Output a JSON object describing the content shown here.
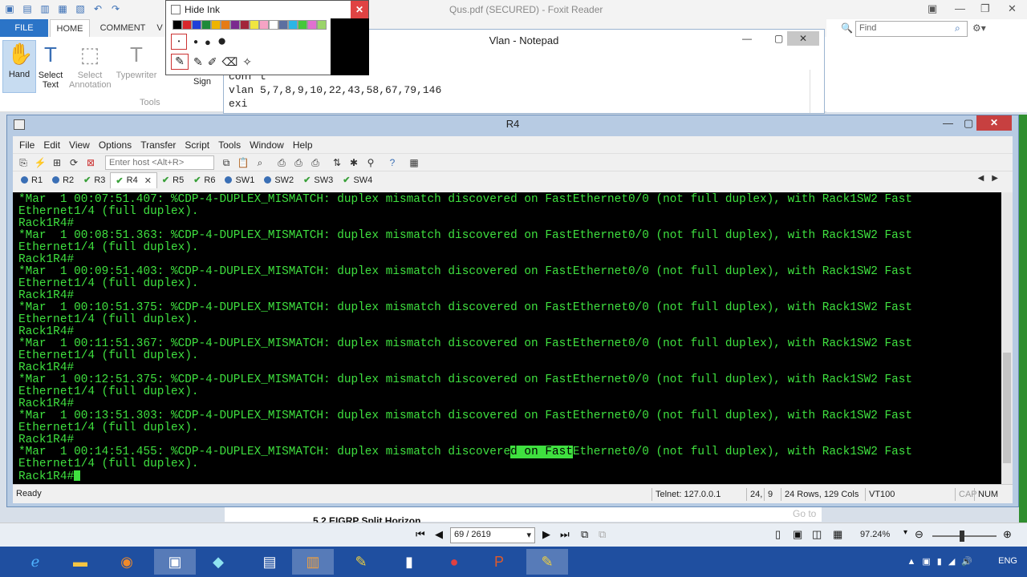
{
  "foxit": {
    "window_title": "Qus.pdf (SECURED) - Foxit Reader",
    "tabs": [
      "FILE",
      "HOME",
      "COMMENT",
      "V"
    ],
    "active_tab": "HOME",
    "ribbon": {
      "hand": "Hand",
      "select_text": "Select Text",
      "select_annotation": "Select Annotation",
      "typewriter": "Typewriter",
      "sign": "Sign",
      "tools_group": "Tools"
    },
    "find_placeholder": "Find",
    "page_heading_peek": "5.2    EIGRP Split Horizon",
    "goto_peek": "Go to",
    "page_selector": "69 / 2619",
    "zoom_level": "97.24%"
  },
  "ink_palette": {
    "hide_ink_label": "Hide Ink",
    "colors": [
      "#000000",
      "#d9262b",
      "#1f3fd9",
      "#1e8a3a",
      "#f0b400",
      "#e67b16",
      "#7b2a8f",
      "#a2253a",
      "#f0e640",
      "#f6a3c4",
      "#ffffff",
      "#5c6fa0",
      "#2bb5e6",
      "#46c83a",
      "#e070d0",
      "#9bd46a"
    ]
  },
  "notepad": {
    "title": "Vlan - Notepad",
    "lines": [
      "conf t",
      "vlan 5,7,8,9,10,22,43,58,67,79,146",
      "exi"
    ]
  },
  "securecrt": {
    "window_title": "R4",
    "menu": [
      "File",
      "Edit",
      "View",
      "Options",
      "Transfer",
      "Script",
      "Tools",
      "Window",
      "Help"
    ],
    "host_placeholder": "Enter host <Alt+R>",
    "sessions": [
      {
        "label": "R1",
        "state": "dot"
      },
      {
        "label": "R2",
        "state": "dot"
      },
      {
        "label": "R3",
        "state": "check"
      },
      {
        "label": "R4",
        "state": "check",
        "active": true
      },
      {
        "label": "R5",
        "state": "check"
      },
      {
        "label": "R6",
        "state": "check"
      },
      {
        "label": "SW1",
        "state": "dot"
      },
      {
        "label": "SW2",
        "state": "dot"
      },
      {
        "label": "SW3",
        "state": "check"
      },
      {
        "label": "SW4",
        "state": "check"
      }
    ],
    "terminal": {
      "log_entries": [
        {
          "msg": "*Mar  1 00:07:51.407: %CDP-4-DUPLEX_MISMATCH: duplex mismatch discovered on FastEthernet0/0 (not full duplex), with Rack1SW2 Fast",
          "cont": "Ethernet1/4 (full duplex)."
        },
        {
          "msg": "*Mar  1 00:08:51.363: %CDP-4-DUPLEX_MISMATCH: duplex mismatch discovered on FastEthernet0/0 (not full duplex), with Rack1SW2 Fast",
          "cont": "Ethernet1/4 (full duplex)."
        },
        {
          "msg": "*Mar  1 00:09:51.403: %CDP-4-DUPLEX_MISMATCH: duplex mismatch discovered on FastEthernet0/0 (not full duplex), with Rack1SW2 Fast",
          "cont": "Ethernet1/4 (full duplex)."
        },
        {
          "msg": "*Mar  1 00:10:51.375: %CDP-4-DUPLEX_MISMATCH: duplex mismatch discovered on FastEthernet0/0 (not full duplex), with Rack1SW2 Fast",
          "cont": "Ethernet1/4 (full duplex)."
        },
        {
          "msg": "*Mar  1 00:11:51.367: %CDP-4-DUPLEX_MISMATCH: duplex mismatch discovered on FastEthernet0/0 (not full duplex), with Rack1SW2 Fast",
          "cont": "Ethernet1/4 (full duplex)."
        },
        {
          "msg": "*Mar  1 00:12:51.375: %CDP-4-DUPLEX_MISMATCH: duplex mismatch discovered on FastEthernet0/0 (not full duplex), with Rack1SW2 Fast",
          "cont": "Ethernet1/4 (full duplex)."
        },
        {
          "msg": "*Mar  1 00:13:51.303: %CDP-4-DUPLEX_MISMATCH: duplex mismatch discovered on FastEthernet0/0 (not full duplex), with Rack1SW2 Fast",
          "cont": "Ethernet1/4 (full duplex)."
        }
      ],
      "prompt": "Rack1R4#",
      "last_before": "*Mar  1 00:14:51.455: %CDP-4-DUPLEX_MISMATCH: duplex mismatch discovere",
      "last_highlight": "d on Fast",
      "last_after": "Ethernet0/0 (not full duplex), with Rack1SW2 Fast",
      "last_cont": "Ethernet1/4 (full duplex)."
    },
    "status": {
      "ready": "Ready",
      "connection": "Telnet: 127.0.0.1",
      "row": "24,",
      "col": "9",
      "size": "24 Rows, 129 Cols",
      "emulation": "VT100",
      "caps": "CAP",
      "num": "NUM"
    }
  },
  "taskbar": {
    "language": "ENG"
  }
}
